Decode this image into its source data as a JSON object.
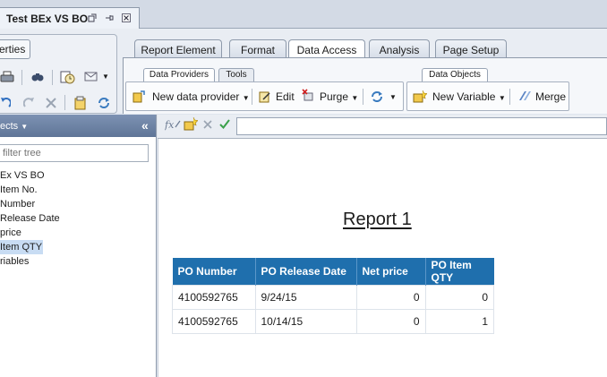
{
  "document": {
    "tab_title": "Test BEx VS BO"
  },
  "left_toolbar": {
    "properties_label": "erties"
  },
  "ribbon": {
    "tabs": [
      {
        "label": "Report Element"
      },
      {
        "label": "Format"
      },
      {
        "label": "Data Access",
        "active": true
      },
      {
        "label": "Analysis"
      },
      {
        "label": "Page Setup"
      }
    ],
    "sub_tabs": {
      "data_providers": "Data Providers",
      "tools": "Tools",
      "data_objects": "Data Objects"
    },
    "buttons": {
      "new_data_provider": "New data provider",
      "edit": "Edit",
      "purge": "Purge",
      "new_variable": "New Variable",
      "merge": "Merge"
    }
  },
  "side_panel": {
    "title": "ects",
    "filter_placeholder": "filter tree",
    "items": [
      "Ex VS BO",
      "Item No.",
      "Number",
      "Release Date",
      "price",
      "Item QTY",
      "riables"
    ],
    "selected_index": 5
  },
  "formula_bar": {
    "value": ""
  },
  "report": {
    "title": "Report 1",
    "columns": [
      "PO Number",
      "PO Release Date",
      "Net price",
      "PO Item QTY"
    ],
    "rows": [
      [
        "4100592765",
        "9/24/15",
        "0",
        "0"
      ],
      [
        "4100592765",
        "10/14/15",
        "0",
        "1"
      ]
    ]
  },
  "colors": {
    "table_header": "#1f6fad",
    "panel_header": "#6a7fa2",
    "selection": "#c8dcf3"
  }
}
